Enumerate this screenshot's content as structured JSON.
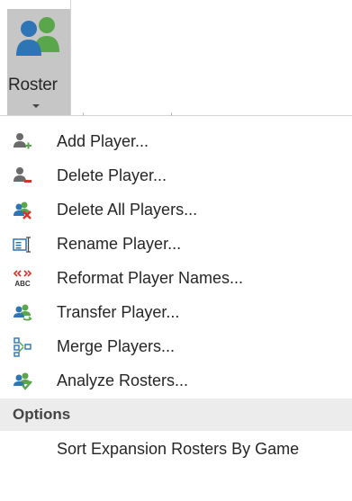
{
  "ribbon": {
    "roster_label": "Roster"
  },
  "menu": {
    "items": [
      {
        "label": "Add Player...",
        "icon": "add-player-icon"
      },
      {
        "label": "Delete Player...",
        "icon": "delete-player-icon"
      },
      {
        "label": "Delete All Players...",
        "icon": "delete-all-players-icon"
      },
      {
        "label": "Rename Player...",
        "icon": "rename-player-icon"
      },
      {
        "label": "Reformat Player Names...",
        "icon": "reformat-names-icon"
      },
      {
        "label": "Transfer Player...",
        "icon": "transfer-player-icon"
      },
      {
        "label": "Merge Players...",
        "icon": "merge-players-icon"
      },
      {
        "label": "Analyze Rosters...",
        "icon": "analyze-rosters-icon"
      }
    ],
    "section_title": "Options",
    "option_item": "Sort Expansion Rosters By Game"
  },
  "colors": {
    "green": "#5aa64b",
    "blue": "#2e75b6",
    "red": "#d9342b",
    "gray_person": "#6b6b6b"
  }
}
